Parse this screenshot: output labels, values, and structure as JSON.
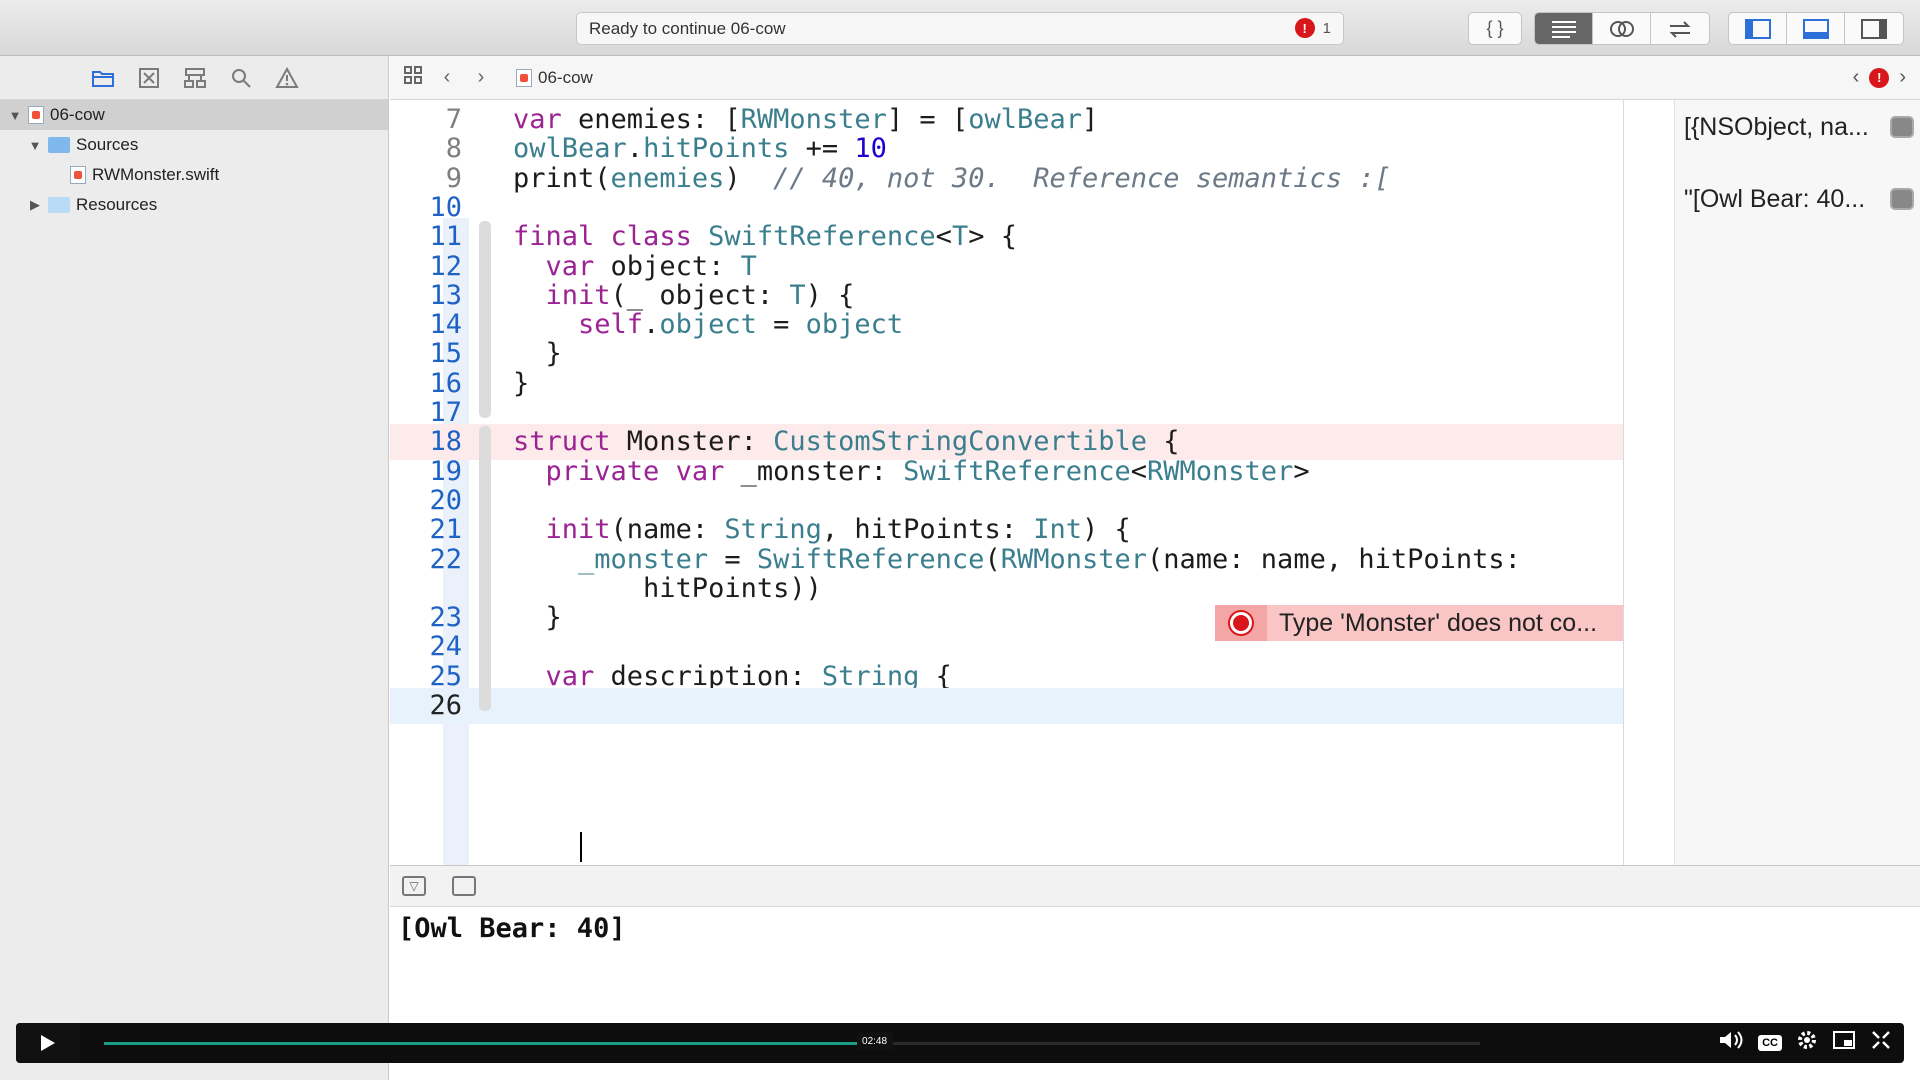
{
  "toolbar": {
    "status_text": "Ready to continue 06-cow",
    "error_count": "1",
    "error_glyph": "!",
    "btn_braces": "{ }",
    "editor_modes": [
      "standard-editor",
      "assistant-editor",
      "version-editor"
    ],
    "panels": [
      "navigator",
      "debug-area",
      "utilities"
    ]
  },
  "navigator": {
    "tabs": [
      "project-navigator",
      "source-control",
      "symbol-navigator",
      "find-navigator",
      "issue-navigator"
    ],
    "tree": [
      {
        "label": "06-cow",
        "type": "playground",
        "expanded": true,
        "selected": true
      },
      {
        "label": "Sources",
        "type": "folder",
        "expanded": true
      },
      {
        "label": "RWMonster.swift",
        "type": "swift-file"
      },
      {
        "label": "Resources",
        "type": "folder",
        "expanded": false
      }
    ]
  },
  "jumpbar": {
    "file": "06-cow"
  },
  "editor": {
    "lines": [
      {
        "n": "7",
        "code": "var enemies: [RWMonster] = [owlBear]"
      },
      {
        "n": "8",
        "code": "owlBear.hitPoints += 10"
      },
      {
        "n": "9",
        "code": "print(enemies)  // 40, not 30.  Reference semantics :["
      },
      {
        "n": "10",
        "code": ""
      },
      {
        "n": "11",
        "code": "final class SwiftReference<T> {"
      },
      {
        "n": "12",
        "code": "  var object: T"
      },
      {
        "n": "13",
        "code": "  init(_ object: T) {"
      },
      {
        "n": "14",
        "code": "    self.object = object"
      },
      {
        "n": "15",
        "code": "  }"
      },
      {
        "n": "16",
        "code": "}"
      },
      {
        "n": "17",
        "code": ""
      },
      {
        "n": "18",
        "code": "struct Monster: CustomStringConvertible {"
      },
      {
        "n": "19",
        "code": "  private var _monster: SwiftReference<RWMonster>"
      },
      {
        "n": "20",
        "code": ""
      },
      {
        "n": "21",
        "code": "  init(name: String, hitPoints: Int) {"
      },
      {
        "n": "22",
        "code": "    _monster = SwiftReference(RWMonster(name: name, hitPoints:"
      },
      {
        "n": "",
        "code": "        hitPoints))"
      },
      {
        "n": "23",
        "code": "  }"
      },
      {
        "n": "24",
        "code": ""
      },
      {
        "n": "25",
        "code": "  var description: String {"
      },
      {
        "n": "26",
        "code": ""
      }
    ],
    "error_message": "Type 'Monster' does not co..."
  },
  "results": {
    "r1": "[{NSObject, na...",
    "r2": "\"[Owl Bear: 40..."
  },
  "console": {
    "output": "[Owl Bear: 40]"
  },
  "player": {
    "time": "02:48",
    "progress": 0.56
  }
}
